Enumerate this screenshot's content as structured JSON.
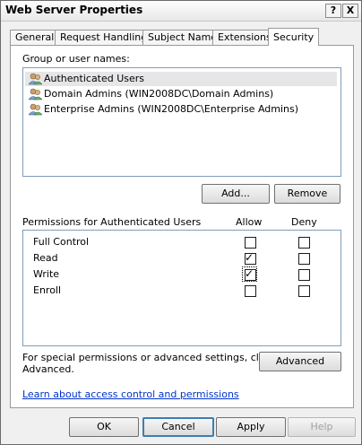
{
  "window": {
    "title": "Web Server Properties",
    "help_button": "?",
    "close_button": "X"
  },
  "tabs": [
    {
      "label": "General"
    },
    {
      "label": "Request Handling"
    },
    {
      "label": "Subject Name"
    },
    {
      "label": "Extensions"
    },
    {
      "label": "Security",
      "active": true
    }
  ],
  "security": {
    "group_label": "Group or user names:",
    "groups": [
      {
        "name": "Authenticated Users",
        "selected": true
      },
      {
        "name": "Domain Admins (WIN2008DC\\Domain Admins)"
      },
      {
        "name": "Enterprise Admins (WIN2008DC\\Enterprise Admins)"
      }
    ],
    "add_button": "Add...",
    "remove_button": "Remove",
    "permissions_label": "Permissions for Authenticated Users",
    "allow_header": "Allow",
    "deny_header": "Deny",
    "permissions": [
      {
        "name": "Full Control",
        "allow": false,
        "deny": false
      },
      {
        "name": "Read",
        "allow": true,
        "deny": false
      },
      {
        "name": "Write",
        "allow": true,
        "deny": false
      },
      {
        "name": "Enroll",
        "allow": false,
        "deny": false
      }
    ],
    "special_text_line1": "For special permissions or advanced settings, click",
    "special_text_line2": "Advanced.",
    "advanced_button": "Advanced",
    "learn_link": "Learn about access control and permissions"
  },
  "footer": {
    "ok": "OK",
    "cancel": "Cancel",
    "apply": "Apply",
    "help": "Help"
  },
  "colors": {
    "checkmark": "#000000",
    "link": "#0033cc",
    "selection": "#e6e6e6"
  }
}
